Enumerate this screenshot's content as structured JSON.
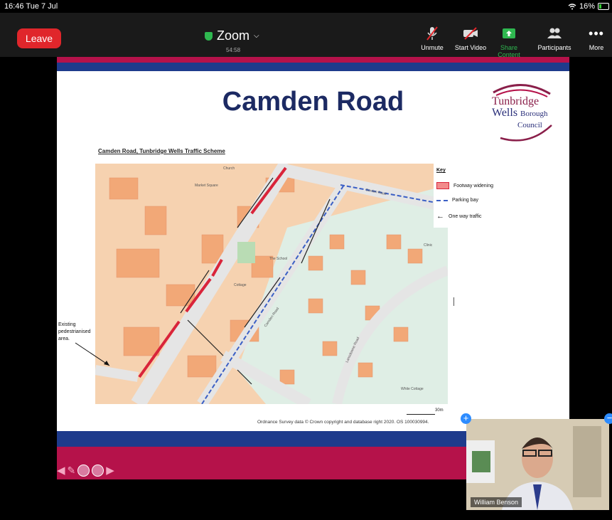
{
  "status": {
    "time": "16:46",
    "date": "Tue 7 Jul",
    "battery": "16%"
  },
  "meeting": {
    "title": "Zoom",
    "timer": "54:58",
    "leave_label": "Leave"
  },
  "toolbar": {
    "unmute": "Unmute",
    "start_video": "Start Video",
    "share_content": "Share Content",
    "participants": "Participants",
    "more": "More"
  },
  "slide": {
    "title": "Camden Road",
    "logo": {
      "line1": "Tunbridge",
      "line2": "Wells",
      "line2b": "Borough",
      "line3": "Council"
    },
    "map_caption": "Camden Road, Tunbridge Wells Traffic Scheme",
    "key": {
      "title": "Key",
      "items": [
        "Footway widening",
        "Parking bay",
        "One way traffic"
      ]
    },
    "pedestrian_note": "Existing pedestrianised area.",
    "map_labels": [
      "Garden Road",
      "Market Square",
      "The School",
      "Cottage",
      "Lansdowne Road",
      "Camden Road",
      "White Cottage",
      "Clinic",
      "Church"
    ],
    "scale": "30m",
    "credits": "Ordnance Survey data © Crown copyright and database right 2020. OS 100030994."
  },
  "video": {
    "participant_name": "William Benson"
  },
  "colors": {
    "brand_red": "#b5124a",
    "brand_blue": "#1e3b8c",
    "leave_red": "#e0262b",
    "share_green": "#2fb850"
  }
}
